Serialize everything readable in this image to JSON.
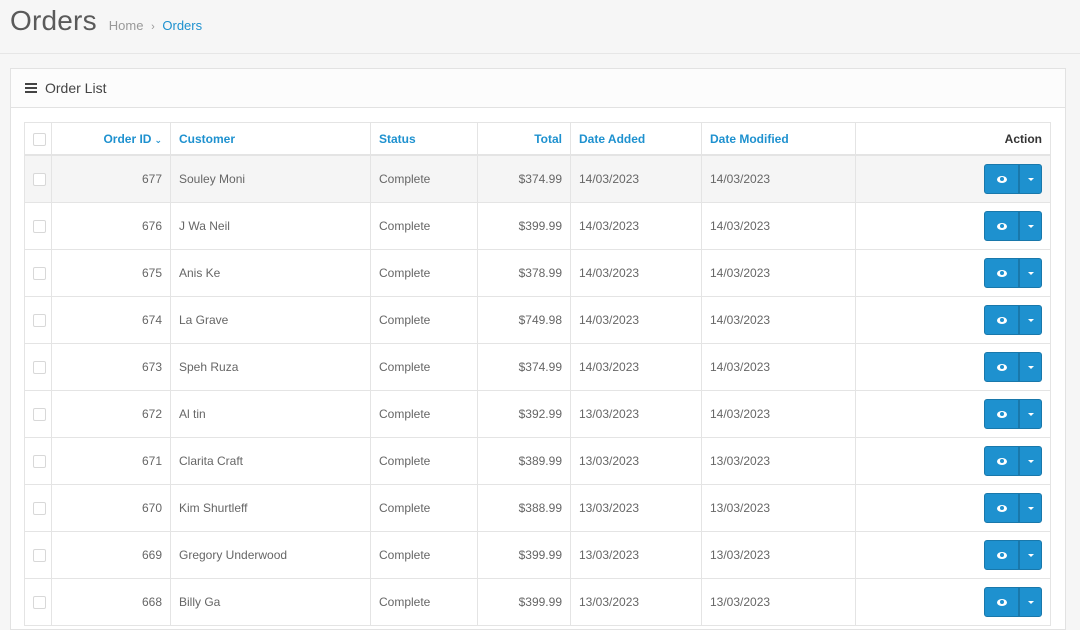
{
  "header": {
    "title": "Orders",
    "breadcrumb": [
      {
        "label": "Home"
      },
      {
        "label": "Orders"
      }
    ],
    "breadcrumb_sep": "›"
  },
  "panel": {
    "title": "Order List"
  },
  "table": {
    "columns": {
      "order_id": "Order ID",
      "customer": "Customer",
      "status": "Status",
      "total": "Total",
      "date_added": "Date Added",
      "date_modified": "Date Modified",
      "action": "Action"
    },
    "sort_indicator": "⌄",
    "rows": [
      {
        "id": "677",
        "customer": "Souley Moni",
        "status": "Complete",
        "total": "$374.99",
        "added": "14/03/2023",
        "modified": "14/03/2023"
      },
      {
        "id": "676",
        "customer": "J Wa Neil",
        "status": "Complete",
        "total": "$399.99",
        "added": "14/03/2023",
        "modified": "14/03/2023"
      },
      {
        "id": "675",
        "customer": "Anis Ke",
        "status": "Complete",
        "total": "$378.99",
        "added": "14/03/2023",
        "modified": "14/03/2023"
      },
      {
        "id": "674",
        "customer": "La Grave",
        "status": "Complete",
        "total": "$749.98",
        "added": "14/03/2023",
        "modified": "14/03/2023"
      },
      {
        "id": "673",
        "customer": "Speh Ruza",
        "status": "Complete",
        "total": "$374.99",
        "added": "14/03/2023",
        "modified": "14/03/2023"
      },
      {
        "id": "672",
        "customer": "Al tin",
        "status": "Complete",
        "total": "$392.99",
        "added": "13/03/2023",
        "modified": "14/03/2023"
      },
      {
        "id": "671",
        "customer": "Clarita Craft",
        "status": "Complete",
        "total": "$389.99",
        "added": "13/03/2023",
        "modified": "13/03/2023"
      },
      {
        "id": "670",
        "customer": "Kim Shurtleff",
        "status": "Complete",
        "total": "$388.99",
        "added": "13/03/2023",
        "modified": "13/03/2023"
      },
      {
        "id": "669",
        "customer": "Gregory Underwood",
        "status": "Complete",
        "total": "$399.99",
        "added": "13/03/2023",
        "modified": "13/03/2023"
      },
      {
        "id": "668",
        "customer": "Billy Ga",
        "status": "Complete",
        "total": "$399.99",
        "added": "13/03/2023",
        "modified": "13/03/2023"
      }
    ]
  },
  "icons": {
    "panel": "list-icon",
    "view": "eye-icon",
    "dropdown": "caret-down-icon"
  },
  "colors": {
    "accent": "#1e91cf",
    "button_border": "#1978ab"
  }
}
